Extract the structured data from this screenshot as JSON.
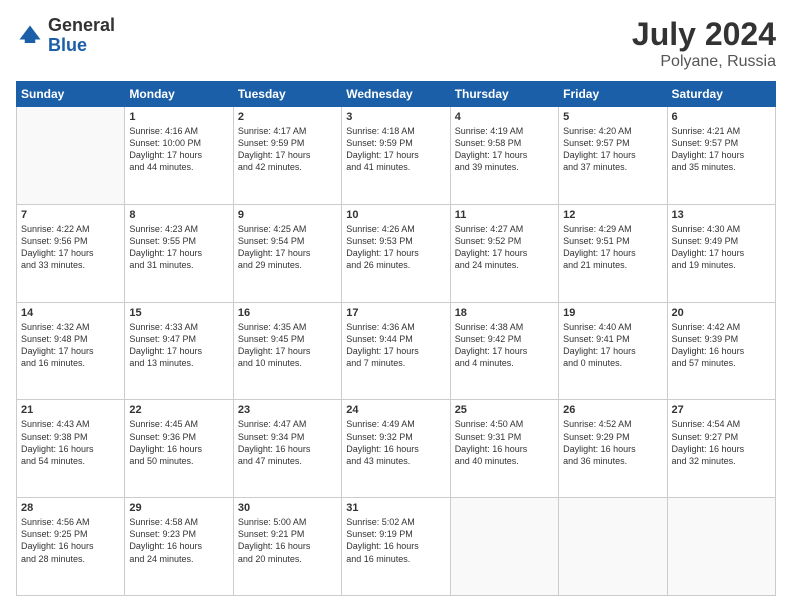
{
  "header": {
    "logo_general": "General",
    "logo_blue": "Blue",
    "month_year": "July 2024",
    "location": "Polyane, Russia"
  },
  "days_of_week": [
    "Sunday",
    "Monday",
    "Tuesday",
    "Wednesday",
    "Thursday",
    "Friday",
    "Saturday"
  ],
  "weeks": [
    [
      {
        "day": "",
        "text": ""
      },
      {
        "day": "1",
        "text": "Sunrise: 4:16 AM\nSunset: 10:00 PM\nDaylight: 17 hours\nand 44 minutes."
      },
      {
        "day": "2",
        "text": "Sunrise: 4:17 AM\nSunset: 9:59 PM\nDaylight: 17 hours\nand 42 minutes."
      },
      {
        "day": "3",
        "text": "Sunrise: 4:18 AM\nSunset: 9:59 PM\nDaylight: 17 hours\nand 41 minutes."
      },
      {
        "day": "4",
        "text": "Sunrise: 4:19 AM\nSunset: 9:58 PM\nDaylight: 17 hours\nand 39 minutes."
      },
      {
        "day": "5",
        "text": "Sunrise: 4:20 AM\nSunset: 9:57 PM\nDaylight: 17 hours\nand 37 minutes."
      },
      {
        "day": "6",
        "text": "Sunrise: 4:21 AM\nSunset: 9:57 PM\nDaylight: 17 hours\nand 35 minutes."
      }
    ],
    [
      {
        "day": "7",
        "text": "Sunrise: 4:22 AM\nSunset: 9:56 PM\nDaylight: 17 hours\nand 33 minutes."
      },
      {
        "day": "8",
        "text": "Sunrise: 4:23 AM\nSunset: 9:55 PM\nDaylight: 17 hours\nand 31 minutes."
      },
      {
        "day": "9",
        "text": "Sunrise: 4:25 AM\nSunset: 9:54 PM\nDaylight: 17 hours\nand 29 minutes."
      },
      {
        "day": "10",
        "text": "Sunrise: 4:26 AM\nSunset: 9:53 PM\nDaylight: 17 hours\nand 26 minutes."
      },
      {
        "day": "11",
        "text": "Sunrise: 4:27 AM\nSunset: 9:52 PM\nDaylight: 17 hours\nand 24 minutes."
      },
      {
        "day": "12",
        "text": "Sunrise: 4:29 AM\nSunset: 9:51 PM\nDaylight: 17 hours\nand 21 minutes."
      },
      {
        "day": "13",
        "text": "Sunrise: 4:30 AM\nSunset: 9:49 PM\nDaylight: 17 hours\nand 19 minutes."
      }
    ],
    [
      {
        "day": "14",
        "text": "Sunrise: 4:32 AM\nSunset: 9:48 PM\nDaylight: 17 hours\nand 16 minutes."
      },
      {
        "day": "15",
        "text": "Sunrise: 4:33 AM\nSunset: 9:47 PM\nDaylight: 17 hours\nand 13 minutes."
      },
      {
        "day": "16",
        "text": "Sunrise: 4:35 AM\nSunset: 9:45 PM\nDaylight: 17 hours\nand 10 minutes."
      },
      {
        "day": "17",
        "text": "Sunrise: 4:36 AM\nSunset: 9:44 PM\nDaylight: 17 hours\nand 7 minutes."
      },
      {
        "day": "18",
        "text": "Sunrise: 4:38 AM\nSunset: 9:42 PM\nDaylight: 17 hours\nand 4 minutes."
      },
      {
        "day": "19",
        "text": "Sunrise: 4:40 AM\nSunset: 9:41 PM\nDaylight: 17 hours\nand 0 minutes."
      },
      {
        "day": "20",
        "text": "Sunrise: 4:42 AM\nSunset: 9:39 PM\nDaylight: 16 hours\nand 57 minutes."
      }
    ],
    [
      {
        "day": "21",
        "text": "Sunrise: 4:43 AM\nSunset: 9:38 PM\nDaylight: 16 hours\nand 54 minutes."
      },
      {
        "day": "22",
        "text": "Sunrise: 4:45 AM\nSunset: 9:36 PM\nDaylight: 16 hours\nand 50 minutes."
      },
      {
        "day": "23",
        "text": "Sunrise: 4:47 AM\nSunset: 9:34 PM\nDaylight: 16 hours\nand 47 minutes."
      },
      {
        "day": "24",
        "text": "Sunrise: 4:49 AM\nSunset: 9:32 PM\nDaylight: 16 hours\nand 43 minutes."
      },
      {
        "day": "25",
        "text": "Sunrise: 4:50 AM\nSunset: 9:31 PM\nDaylight: 16 hours\nand 40 minutes."
      },
      {
        "day": "26",
        "text": "Sunrise: 4:52 AM\nSunset: 9:29 PM\nDaylight: 16 hours\nand 36 minutes."
      },
      {
        "day": "27",
        "text": "Sunrise: 4:54 AM\nSunset: 9:27 PM\nDaylight: 16 hours\nand 32 minutes."
      }
    ],
    [
      {
        "day": "28",
        "text": "Sunrise: 4:56 AM\nSunset: 9:25 PM\nDaylight: 16 hours\nand 28 minutes."
      },
      {
        "day": "29",
        "text": "Sunrise: 4:58 AM\nSunset: 9:23 PM\nDaylight: 16 hours\nand 24 minutes."
      },
      {
        "day": "30",
        "text": "Sunrise: 5:00 AM\nSunset: 9:21 PM\nDaylight: 16 hours\nand 20 minutes."
      },
      {
        "day": "31",
        "text": "Sunrise: 5:02 AM\nSunset: 9:19 PM\nDaylight: 16 hours\nand 16 minutes."
      },
      {
        "day": "",
        "text": ""
      },
      {
        "day": "",
        "text": ""
      },
      {
        "day": "",
        "text": ""
      }
    ]
  ]
}
